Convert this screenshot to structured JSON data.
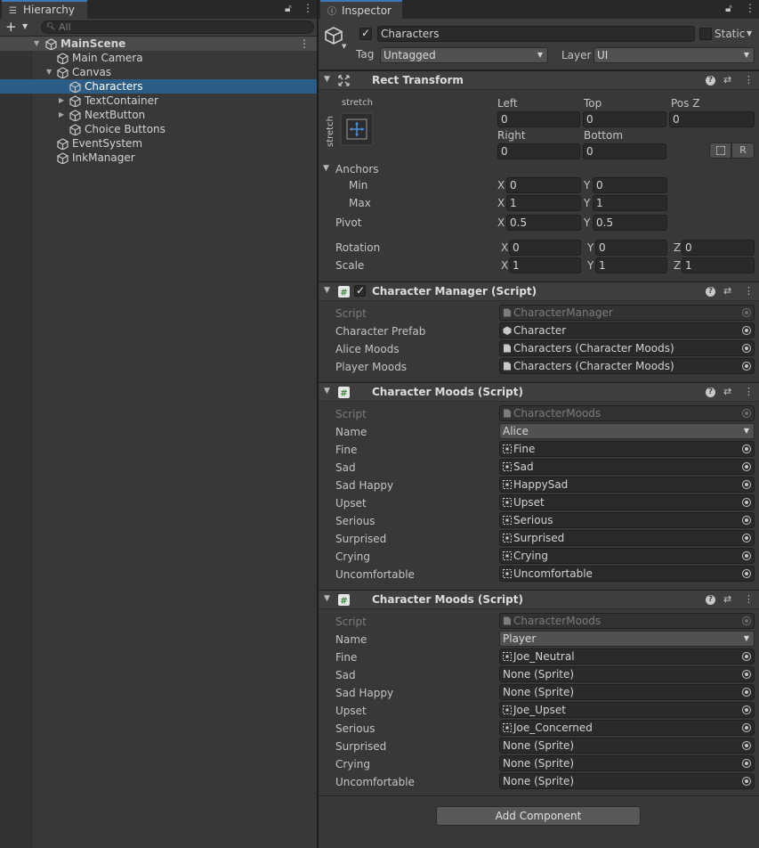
{
  "hierarchy": {
    "tab_label": "Hierarchy",
    "search_placeholder": "All",
    "scene": "MainScene",
    "items": [
      {
        "label": "Main Camera"
      },
      {
        "label": "Canvas"
      },
      {
        "label": "Characters"
      },
      {
        "label": "TextContainer"
      },
      {
        "label": "NextButton"
      },
      {
        "label": "Choice Buttons"
      },
      {
        "label": "EventSystem"
      },
      {
        "label": "InkManager"
      }
    ]
  },
  "inspector": {
    "tab_label": "Inspector",
    "object_name": "Characters",
    "static_label": "Static",
    "tag_label": "Tag",
    "tag_value": "Untagged",
    "layer_label": "Layer",
    "layer_value": "UI",
    "rect_transform": {
      "title": "Rect Transform",
      "anchor_preset_top": "stretch",
      "anchor_preset_side": "stretch",
      "left_label": "Left",
      "left": "0",
      "top_label": "Top",
      "top": "0",
      "posz_label": "Pos Z",
      "posz": "0",
      "right_label": "Right",
      "right": "0",
      "bottom_label": "Bottom",
      "bottom": "0",
      "r_button": "R",
      "anchors_label": "Anchors",
      "min_label": "Min",
      "min_x": "0",
      "min_y": "0",
      "max_label": "Max",
      "max_x": "1",
      "max_y": "1",
      "pivot_label": "Pivot",
      "pivot_x": "0.5",
      "pivot_y": "0.5",
      "rotation_label": "Rotation",
      "rot_x": "0",
      "rot_y": "0",
      "rot_z": "0",
      "scale_label": "Scale",
      "scale_x": "1",
      "scale_y": "1",
      "scale_z": "1",
      "axis_x": "X",
      "axis_y": "Y",
      "axis_z": "Z"
    },
    "character_manager": {
      "title": "Character Manager (Script)",
      "props": [
        {
          "label": "Script",
          "value": "CharacterManager"
        },
        {
          "label": "Character Prefab",
          "value": "Character"
        },
        {
          "label": "Alice Moods",
          "value": "Characters (Character Moods)"
        },
        {
          "label": "Player Moods",
          "value": "Characters (Character Moods)"
        }
      ]
    },
    "moods_alice": {
      "title": "Character Moods (Script)",
      "script_label": "Script",
      "script_value": "CharacterMoods",
      "name_label": "Name",
      "name_value": "Alice",
      "props": [
        {
          "label": "Fine",
          "value": "Fine"
        },
        {
          "label": "Sad",
          "value": "Sad"
        },
        {
          "label": "Sad Happy",
          "value": "HappySad"
        },
        {
          "label": "Upset",
          "value": "Upset"
        },
        {
          "label": "Serious",
          "value": "Serious"
        },
        {
          "label": "Surprised",
          "value": "Surprised"
        },
        {
          "label": "Crying",
          "value": "Crying"
        },
        {
          "label": "Uncomfortable",
          "value": "Uncomfortable"
        }
      ]
    },
    "moods_player": {
      "title": "Character Moods (Script)",
      "script_label": "Script",
      "script_value": "CharacterMoods",
      "name_label": "Name",
      "name_value": "Player",
      "props": [
        {
          "label": "Fine",
          "value": "Joe_Neutral"
        },
        {
          "label": "Sad",
          "value": "None (Sprite)"
        },
        {
          "label": "Sad Happy",
          "value": "None (Sprite)"
        },
        {
          "label": "Upset",
          "value": "Joe_Upset"
        },
        {
          "label": "Serious",
          "value": "Joe_Concerned"
        },
        {
          "label": "Surprised",
          "value": "None (Sprite)"
        },
        {
          "label": "Crying",
          "value": "None (Sprite)"
        },
        {
          "label": "Uncomfortable",
          "value": "None (Sprite)"
        }
      ]
    },
    "add_component": "Add Component"
  }
}
